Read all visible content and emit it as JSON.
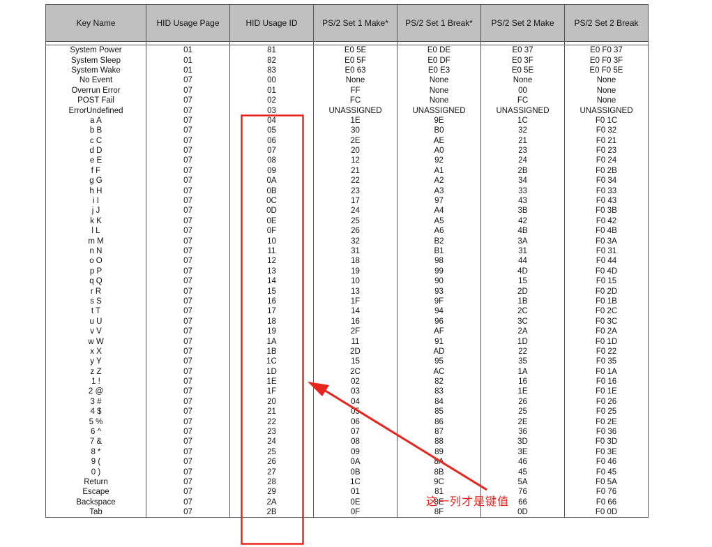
{
  "table": {
    "headers": [
      "Key Name",
      "HID Usage Page",
      "HID Usage ID",
      "PS/2 Set 1 Make*",
      "PS/2 Set 1 Break*",
      "PS/2 Set 2 Make",
      "PS/2 Set 2 Break"
    ],
    "rows": [
      [
        "System Power",
        "01",
        "81",
        "E0 5E",
        "E0 DE",
        "E0 37",
        "E0 F0 37"
      ],
      [
        "System Sleep",
        "01",
        "82",
        "E0 5F",
        "E0 DF",
        "E0 3F",
        "E0 F0 3F"
      ],
      [
        "System Wake",
        "01",
        "83",
        "E0 63",
        "E0 E3",
        "E0 5E",
        "E0 F0 5E"
      ],
      [
        "No Event",
        "07",
        "00",
        "None",
        "None",
        "None",
        "None"
      ],
      [
        "Overrun Error",
        "07",
        "01",
        "FF",
        "None",
        "00",
        "None"
      ],
      [
        "POST Fail",
        "07",
        "02",
        "FC",
        "None",
        "FC",
        "None"
      ],
      [
        "ErrorUndefined",
        "07",
        "03",
        "UNASSIGNED",
        "UNASSIGNED",
        "UNASSIGNED",
        "UNASSIGNED"
      ],
      [
        "a A",
        "07",
        "04",
        "1E",
        "9E",
        "1C",
        "F0 1C"
      ],
      [
        "b B",
        "07",
        "05",
        "30",
        "B0",
        "32",
        "F0 32"
      ],
      [
        "c C",
        "07",
        "06",
        "2E",
        "AE",
        "21",
        "F0 21"
      ],
      [
        "d D",
        "07",
        "07",
        "20",
        "A0",
        "23",
        "F0 23"
      ],
      [
        "e E",
        "07",
        "08",
        "12",
        "92",
        "24",
        "F0 24"
      ],
      [
        "f F",
        "07",
        "09",
        "21",
        "A1",
        "2B",
        "F0 2B"
      ],
      [
        "g G",
        "07",
        "0A",
        "22",
        "A2",
        "34",
        "F0 34"
      ],
      [
        "h H",
        "07",
        "0B",
        "23",
        "A3",
        "33",
        "F0 33"
      ],
      [
        "i I",
        "07",
        "0C",
        "17",
        "97",
        "43",
        "F0 43"
      ],
      [
        "j J",
        "07",
        "0D",
        "24",
        "A4",
        "3B",
        "F0 3B"
      ],
      [
        "k K",
        "07",
        "0E",
        "25",
        "A5",
        "42",
        "F0 42"
      ],
      [
        "l L",
        "07",
        "0F",
        "26",
        "A6",
        "4B",
        "F0 4B"
      ],
      [
        "m M",
        "07",
        "10",
        "32",
        "B2",
        "3A",
        "F0 3A"
      ],
      [
        "n N",
        "07",
        "11",
        "31",
        "B1",
        "31",
        "F0 31"
      ],
      [
        "o O",
        "07",
        "12",
        "18",
        "98",
        "44",
        "F0 44"
      ],
      [
        "p P",
        "07",
        "13",
        "19",
        "99",
        "4D",
        "F0 4D"
      ],
      [
        "q Q",
        "07",
        "14",
        "10",
        "90",
        "15",
        "F0 15"
      ],
      [
        "r R",
        "07",
        "15",
        "13",
        "93",
        "2D",
        "F0 2D"
      ],
      [
        "s S",
        "07",
        "16",
        "1F",
        "9F",
        "1B",
        "F0 1B"
      ],
      [
        "t T",
        "07",
        "17",
        "14",
        "94",
        "2C",
        "F0 2C"
      ],
      [
        "u U",
        "07",
        "18",
        "16",
        "96",
        "3C",
        "F0 3C"
      ],
      [
        "v V",
        "07",
        "19",
        "2F",
        "AF",
        "2A",
        "F0 2A"
      ],
      [
        "w W",
        "07",
        "1A",
        "11",
        "91",
        "1D",
        "F0 1D"
      ],
      [
        "x X",
        "07",
        "1B",
        "2D",
        "AD",
        "22",
        "F0 22"
      ],
      [
        "y Y",
        "07",
        "1C",
        "15",
        "95",
        "35",
        "F0 35"
      ],
      [
        "z Z",
        "07",
        "1D",
        "2C",
        "AC",
        "1A",
        "F0 1A"
      ],
      [
        "1 !",
        "07",
        "1E",
        "02",
        "82",
        "16",
        "F0 16"
      ],
      [
        "2 @",
        "07",
        "1F",
        "03",
        "83",
        "1E",
        "F0 1E"
      ],
      [
        "3 #",
        "07",
        "20",
        "04",
        "84",
        "26",
        "F0 26"
      ],
      [
        "4 $",
        "07",
        "21",
        "05",
        "85",
        "25",
        "F0 25"
      ],
      [
        "5 %",
        "07",
        "22",
        "06",
        "86",
        "2E",
        "F0 2E"
      ],
      [
        "6 ^",
        "07",
        "23",
        "07",
        "87",
        "36",
        "F0 36"
      ],
      [
        "7 &",
        "07",
        "24",
        "08",
        "88",
        "3D",
        "F0 3D"
      ],
      [
        "8 *",
        "07",
        "25",
        "09",
        "89",
        "3E",
        "F0 3E"
      ],
      [
        "9 (",
        "07",
        "26",
        "0A",
        "8A",
        "46",
        "F0 46"
      ],
      [
        "0 )",
        "07",
        "27",
        "0B",
        "8B",
        "45",
        "F0 45"
      ],
      [
        "Return",
        "07",
        "28",
        "1C",
        "9C",
        "5A",
        "F0 5A"
      ],
      [
        "Escape",
        "07",
        "29",
        "01",
        "81",
        "76",
        "F0 76"
      ],
      [
        "Backspace",
        "07",
        "2A",
        "0E",
        "8E",
        "66",
        "F0 66"
      ],
      [
        "Tab",
        "07",
        "2B",
        "0F",
        "8F",
        "0D",
        "F0 0D"
      ]
    ]
  },
  "annotation": {
    "note": "这一列才是键值",
    "color": "#e8241d"
  },
  "colors": {
    "header_background": "#c0c0c0",
    "grid_line": "#555555"
  }
}
